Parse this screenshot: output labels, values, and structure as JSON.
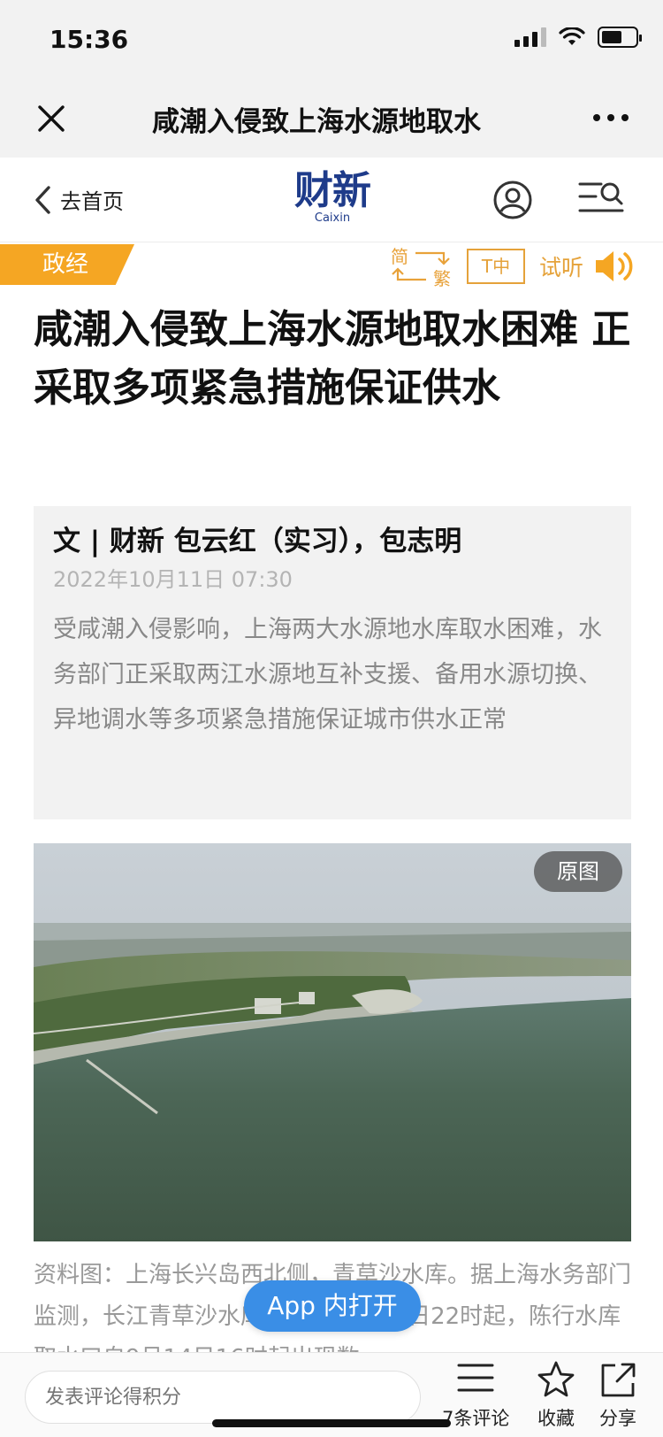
{
  "status_bar": {
    "time": "15:36"
  },
  "nav": {
    "title": "咸潮入侵致上海水源地取水"
  },
  "site_header": {
    "back_label": "去首页",
    "logo_cn": "财新",
    "logo_en": "Caixin"
  },
  "category": {
    "tag": "政经",
    "simplified": "简",
    "traditional": "繁",
    "font_size_toggle": "T中",
    "listen_label": "试听"
  },
  "article": {
    "headline": "咸潮入侵致上海水源地取水困难 正采取多项紧急措施保证供水",
    "author_line": "文 | 财新 包云红（实习），包志明",
    "date": "2022年10月11日 07:30",
    "abstract": "受咸潮入侵影响，上海两大水源地水库取水困难，水务部门正采取两江水源地互补支援、备用水源切换、异地调水等多项紧急措施保证城市供水正常",
    "original_image_label": "原图",
    "caption": "资料图：上海长兴岛西北侧，青草沙水库。据上海水务部门监测，长江青草沙水库取水口自9月5日22时起，陈行水库取水口自9月14日16时起出现数"
  },
  "app_open_button": "App 内打开",
  "bottom_bar": {
    "comment_placeholder": "发表评论得积分",
    "comments_label": "7条评论",
    "favorite_label": "收藏",
    "share_label": "分享"
  },
  "colors": {
    "accent_orange": "#f5a623",
    "logo_blue": "#1e3b8a",
    "app_button_blue": "#3a8ee6"
  }
}
